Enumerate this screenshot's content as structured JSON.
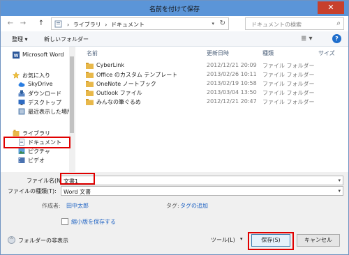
{
  "window": {
    "title": "名前を付けて保存",
    "close_glyph": "✕"
  },
  "address_bar": {
    "back_glyph": "←",
    "forward_glyph": "→",
    "up_glyph": "↑",
    "crumbs": [
      "ライブラリ",
      "ドキュメント"
    ],
    "separator": "›",
    "dropdown_glyph": "▾",
    "refresh_glyph": "↻"
  },
  "search": {
    "placeholder": "ドキュメントの検索",
    "icon_glyph": "⌕"
  },
  "toolbar": {
    "organize_label": "整理 ▾",
    "new_folder_label": "新しいフォルダー",
    "view_glyph": "≣ ▾",
    "help_glyph": "?"
  },
  "nav": {
    "items": [
      {
        "label": "Microsoft Word",
        "icon": "word-icon"
      },
      {
        "label": "お気に入り",
        "icon": "star-icon"
      },
      {
        "label": "SkyDrive",
        "icon": "cloud-icon"
      },
      {
        "label": "ダウンロード",
        "icon": "download-icon"
      },
      {
        "label": "デスクトップ",
        "icon": "desktop-icon"
      },
      {
        "label": "最近表示した場所",
        "icon": "recent-places-icon"
      },
      {
        "label": "ライブラリ",
        "icon": "library-icon"
      },
      {
        "label": "ドキュメント",
        "icon": "documents-icon"
      },
      {
        "label": "ピクチャ",
        "icon": "pictures-icon"
      },
      {
        "label": "ビデオ",
        "icon": "videos-icon"
      }
    ]
  },
  "file_list": {
    "columns": {
      "name": "名前",
      "date": "更新日時",
      "type": "種類",
      "size": "サイズ"
    },
    "rows": [
      {
        "name": "CyberLink",
        "date": "2012/12/21 20:09",
        "type": "ファイル フォルダー"
      },
      {
        "name": "Office のカスタム テンプレート",
        "date": "2013/02/26 10:11",
        "type": "ファイル フォルダー"
      },
      {
        "name": "OneNote ノートブック",
        "date": "2013/02/19 10:58",
        "type": "ファイル フォルダー"
      },
      {
        "name": "Outlook ファイル",
        "date": "2013/03/04 13:50",
        "type": "ファイル フォルダー"
      },
      {
        "name": "みんなの筆ぐるめ",
        "date": "2012/12/21 20:47",
        "type": "ファイル フォルダー"
      }
    ]
  },
  "form": {
    "filename_label": "ファイル名(N):",
    "filename_value": "文書1",
    "filetype_label": "ファイルの種類(T):",
    "filetype_value": "Word 文書",
    "author_label": "作成者:",
    "author_value": "田中太郎",
    "tags_label": "タグ:",
    "tags_value": "タグの追加",
    "thumbnail_label": "縮小版を保存する",
    "dropdown_glyph": "▾"
  },
  "footer": {
    "hide_folders_label": "フォルダーの非表示",
    "hide_glyph": "⌃",
    "tools_label": "ツール(L)",
    "tools_glyph": "▾",
    "save_label": "保存(S)",
    "cancel_label": "キャンセル"
  },
  "colors": {
    "title_bar": "#5b95d8",
    "close_button": "#c7402c",
    "annotation_red": "#e00000",
    "link": "#1f63c3",
    "folder": "#e8b84a"
  }
}
